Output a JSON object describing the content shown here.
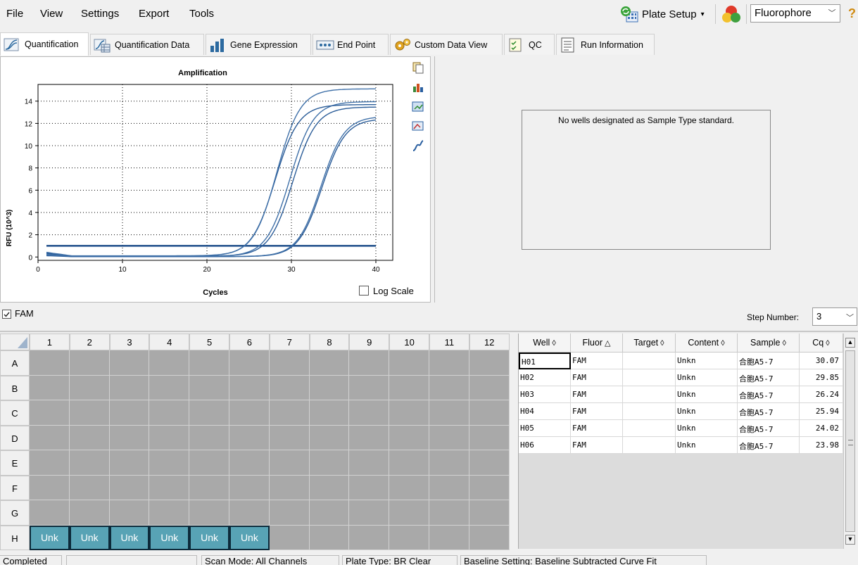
{
  "menu": [
    "File",
    "View",
    "Settings",
    "Export",
    "Tools"
  ],
  "toolbar": {
    "plate_setup_label": "Plate Setup",
    "fluorophore_value": "Fluorophore",
    "help_glyph": "?"
  },
  "tabs": [
    "Quantification",
    "Quantification Data",
    "Gene Expression",
    "End Point",
    "Custom Data View",
    "QC",
    "Run Information"
  ],
  "chart_data": {
    "type": "line",
    "title": "Amplification",
    "xlabel": "Cycles",
    "ylabel": "RFU (10^3)",
    "xlim": [
      0,
      42
    ],
    "ylim": [
      -0.3,
      15.5
    ],
    "xticks": [
      0,
      10,
      20,
      30,
      40
    ],
    "yticks": [
      0,
      2,
      4,
      6,
      8,
      10,
      12,
      14
    ],
    "grid": true,
    "threshold": 1.0,
    "series": [
      {
        "cq": 30.07,
        "baseline": 0.1,
        "plateau": 12.4
      },
      {
        "cq": 29.85,
        "baseline": 0.15,
        "plateau": 12.6
      },
      {
        "cq": 26.24,
        "baseline": 0.25,
        "plateau": 13.4
      },
      {
        "cq": 25.94,
        "baseline": 0.2,
        "plateau": 13.9
      },
      {
        "cq": 24.02,
        "baseline": 0.3,
        "plateau": 13.6
      },
      {
        "cq": 23.98,
        "baseline": 0.35,
        "plateau": 15.0
      }
    ]
  },
  "log_scale_label": "Log Scale",
  "std_message": "No wells designated as Sample Type standard.",
  "fam_label": "FAM",
  "step": {
    "label": "Step Number:",
    "value": "3"
  },
  "plate": {
    "cols": [
      "1",
      "2",
      "3",
      "4",
      "5",
      "6",
      "7",
      "8",
      "9",
      "10",
      "11",
      "12"
    ],
    "rows": [
      "A",
      "B",
      "C",
      "D",
      "E",
      "F",
      "G",
      "H"
    ],
    "unk_label": "Unk"
  },
  "table": {
    "headers": [
      "Well",
      "Fluor",
      "Target",
      "Content",
      "Sample",
      "Cq"
    ],
    "rows": [
      [
        "H01",
        "FAM",
        "",
        "Unkn",
        "合胞A5-7",
        "30.07"
      ],
      [
        "H02",
        "FAM",
        "",
        "Unkn",
        "合胞A5-7",
        "29.85"
      ],
      [
        "H03",
        "FAM",
        "",
        "Unkn",
        "合胞A5-7",
        "26.24"
      ],
      [
        "H04",
        "FAM",
        "",
        "Unkn",
        "合胞A5-7",
        "25.94"
      ],
      [
        "H05",
        "FAM",
        "",
        "Unkn",
        "合胞A5-7",
        "24.02"
      ],
      [
        "H06",
        "FAM",
        "",
        "Unkn",
        "合胞A5-7",
        "23.98"
      ]
    ]
  },
  "status": [
    "Completed",
    "",
    "Scan Mode: All Channels",
    "Plate Type: BR Clear",
    "Baseline Setting: Baseline Subtracted Curve Fit"
  ]
}
